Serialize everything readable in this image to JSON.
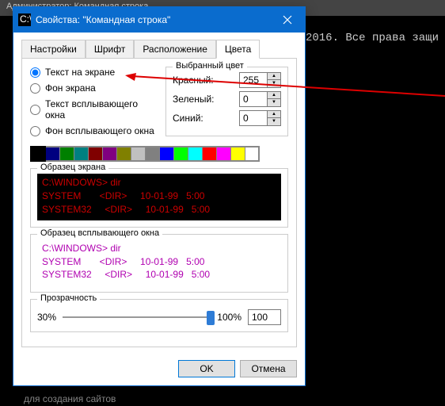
{
  "console": {
    "title": "Администратор: Командная строка",
    "right_text": "2016. Все права защи",
    "bottom_text": "для создания сайтов"
  },
  "dialog": {
    "title": "Свойства: \"Командная строка\"",
    "tabs": [
      "Настройки",
      "Шрифт",
      "Расположение",
      "Цвета"
    ],
    "active_tab": 3,
    "radios": {
      "screen_text": "Текст на экране",
      "screen_bg": "Фон экрана",
      "popup_text": "Текст всплывающего окна",
      "popup_bg": "Фон всплывающего окна"
    },
    "selected_radio": "screen_text",
    "rgb": {
      "title": "Выбранный цвет",
      "red_label": "Красный:",
      "green_label": "Зеленый:",
      "blue_label": "Синий:",
      "red": 255,
      "green": 0,
      "blue": 0
    },
    "palette": [
      "#000000",
      "#000080",
      "#008000",
      "#008080",
      "#800000",
      "#800080",
      "#808000",
      "#c0c0c0",
      "#808080",
      "#0000ff",
      "#00ff00",
      "#00ffff",
      "#ff0000",
      "#ff00ff",
      "#ffff00",
      "#ffffff"
    ],
    "selected_swatch": 0,
    "sample_screen": {
      "title": "Образец экрана",
      "line1": "C:\\WINDOWS> dir",
      "line2": "SYSTEM       <DIR>     10-01-99   5:00",
      "line3": "SYSTEM32     <DIR>     10-01-99   5:00"
    },
    "sample_popup": {
      "title": "Образец всплывающего окна",
      "line1": "C:\\WINDOWS> dir",
      "line2": "SYSTEM       <DIR>     10-01-99   5:00",
      "line3": "SYSTEM32     <DIR>     10-01-99   5:00"
    },
    "transparency": {
      "title": "Прозрачность",
      "min_label": "30%",
      "max_label": "100%",
      "value": 100
    },
    "buttons": {
      "ok": "OK",
      "cancel": "Отмена"
    }
  }
}
